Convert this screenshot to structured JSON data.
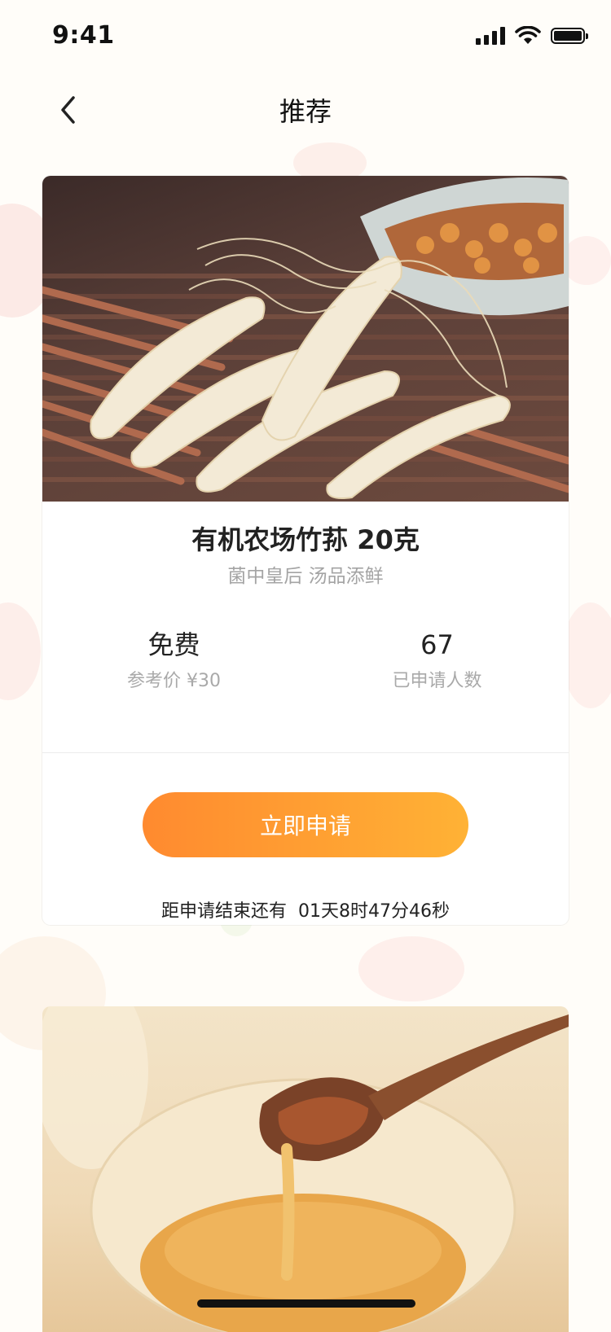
{
  "status_bar": {
    "time": "9:41"
  },
  "nav": {
    "title": "推荐"
  },
  "product": {
    "title": "有机农场竹荪 20克",
    "subtitle": "菌中皇后 汤品添鲜",
    "price_value": "免费",
    "price_label": "参考价 ¥30",
    "applicants_value": "67",
    "applicants_label": "已申请人数",
    "apply_label": "立即申请",
    "countdown": "距申请结束还有  01天8时47分46秒"
  },
  "colors": {
    "accent_start": "#ff8a2f",
    "accent_end": "#ffb235"
  },
  "icons": {
    "back": "chevron-left-icon",
    "signal": "signal-icon",
    "wifi": "wifi-icon",
    "battery": "battery-icon"
  }
}
